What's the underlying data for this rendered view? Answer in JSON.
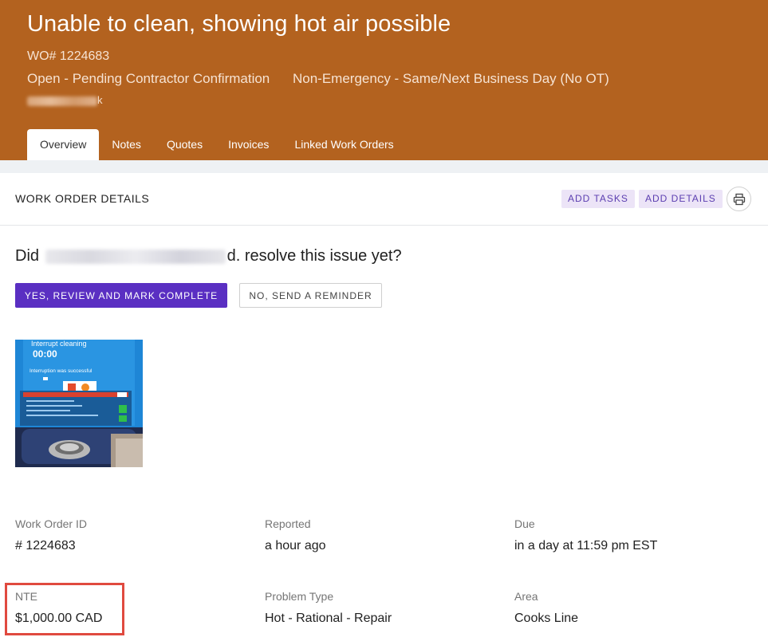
{
  "header": {
    "title": "Unable to clean, showing hot air possible",
    "wo_number": "WO# 1224683",
    "status": "Open - Pending Contractor Confirmation",
    "priority": "Non-Emergency - Same/Next Business Day (No OT)",
    "contact_visible_end": "k",
    "bg_color": "#b3621f"
  },
  "tabs": [
    {
      "label": "Overview",
      "active": true
    },
    {
      "label": "Notes"
    },
    {
      "label": "Quotes"
    },
    {
      "label": "Invoices"
    },
    {
      "label": "Linked Work Orders"
    }
  ],
  "section": {
    "title": "WORK ORDER DETAILS",
    "add_tasks": "ADD TASKS",
    "add_details": "ADD DETAILS",
    "print_icon": "printer-icon"
  },
  "resolve": {
    "question_start": "Did",
    "question_tail": "d. resolve this issue yet?",
    "yes_button": "YES, REVIEW AND MARK COMPLETE",
    "no_button": "NO, SEND A REMINDER",
    "primary_color": "#5a2fc2"
  },
  "photo": {
    "screen_title": "Interrupt cleaning",
    "screen_time": "00:00",
    "screen_message": "Interruption was successful"
  },
  "details": {
    "work_order_id_label": "Work Order ID",
    "work_order_id": "# 1224683",
    "reported_label": "Reported",
    "reported": "a hour ago",
    "due_label": "Due",
    "due": "in a day at 11:59 pm EST",
    "nte_label": "NTE",
    "nte": "$1,000.00 CAD",
    "problem_type_label": "Problem Type",
    "problem_type": "Hot - Rational - Repair",
    "area_label": "Area",
    "area": "Cooks Line",
    "highlight_color": "#e04a3f"
  }
}
